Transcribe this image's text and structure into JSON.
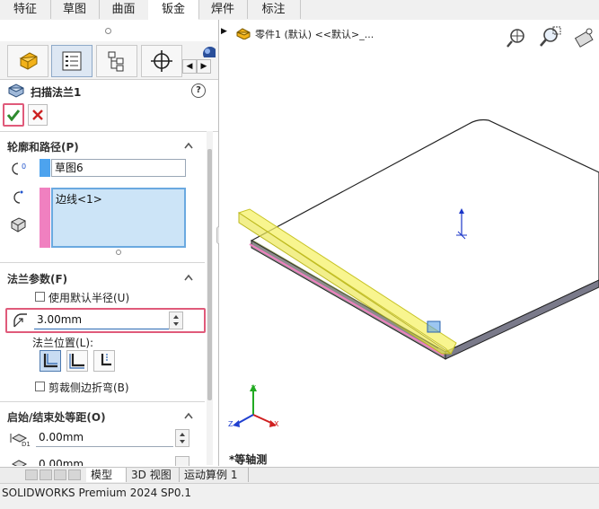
{
  "top_tabs": [
    "特征",
    "草图",
    "曲面",
    "钣金",
    "焊件",
    "标注"
  ],
  "active_top_tab": 3,
  "feature": {
    "title": "扫描法兰1",
    "help_label": "?"
  },
  "panel_tab_icons": [
    "feature-manager-icon",
    "property-manager-icon",
    "configuration-manager-icon",
    "dimxpert-icon",
    "display-manager-icon"
  ],
  "profile_section": {
    "title": "轮廓和路径(P)",
    "profile_value": "草图6",
    "path_value": "边线<1>"
  },
  "flange_section": {
    "title": "法兰参数(F)",
    "use_default_radius_label": "使用默认半径(U)",
    "use_default_radius_checked": false,
    "radius_value": "3.00mm",
    "position_label": "法兰位置(L):",
    "trim_side_bends_label": "剪裁侧边折弯(B)",
    "trim_side_bends_checked": false
  },
  "offset_section": {
    "title": "启始/结束处等距(O)",
    "start_value": "0.00mm",
    "end_value": "0.00mm"
  },
  "viewport": {
    "tree_label": "零件1 (默认) <<默认>_...",
    "view_label": "*等轴测",
    "axis_x": "X",
    "axis_y": "Y",
    "axis_z": "Z"
  },
  "bottom_tabs": [
    "模型",
    "3D 视图",
    "运动算例 1"
  ],
  "active_bottom_tab": 0,
  "status_text": "SOLIDWORKS Premium 2024 SP0.1",
  "colors": {
    "accept_green": "#2e8b2e",
    "cancel_red": "#cc2222",
    "highlight_border": "#e05a7a",
    "selection_fill": "#cce4f7",
    "pink_bar": "#f080c0",
    "blue_bar": "#4da3ee",
    "highlight_yellow": "#f5f26a"
  }
}
